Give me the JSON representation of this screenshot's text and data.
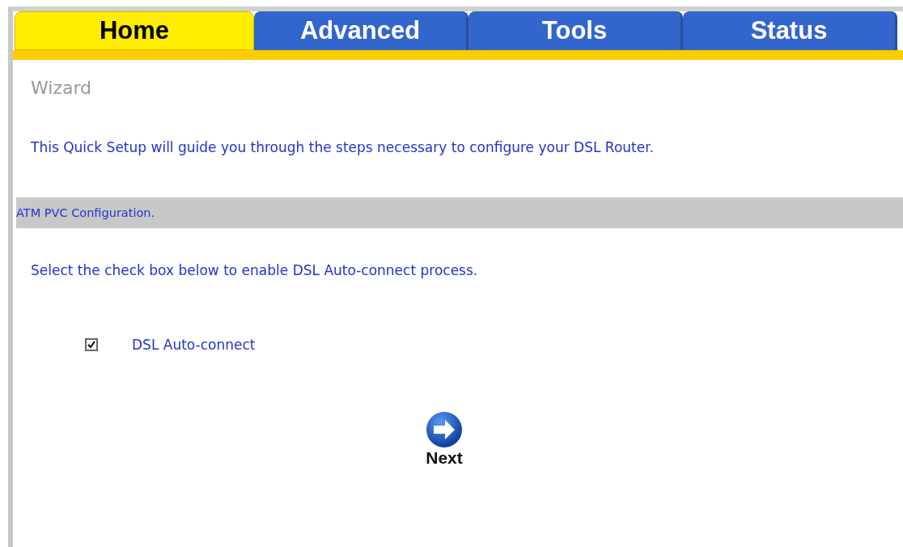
{
  "tabs": [
    {
      "label": "Home",
      "selected": true
    },
    {
      "label": "Advanced",
      "selected": false
    },
    {
      "label": "Tools",
      "selected": false
    },
    {
      "label": "Status",
      "selected": false
    }
  ],
  "page_title": "Wizard",
  "intro": "This Quick Setup will guide you through the steps necessary to configure your DSL Router.",
  "section_header": "ATM PVC Configuration.",
  "instruction": "Select the check box below to enable DSL Auto-connect process.",
  "option": {
    "label": "DSL Auto-connect",
    "checked": true
  },
  "next_button": {
    "label": "Next"
  }
}
